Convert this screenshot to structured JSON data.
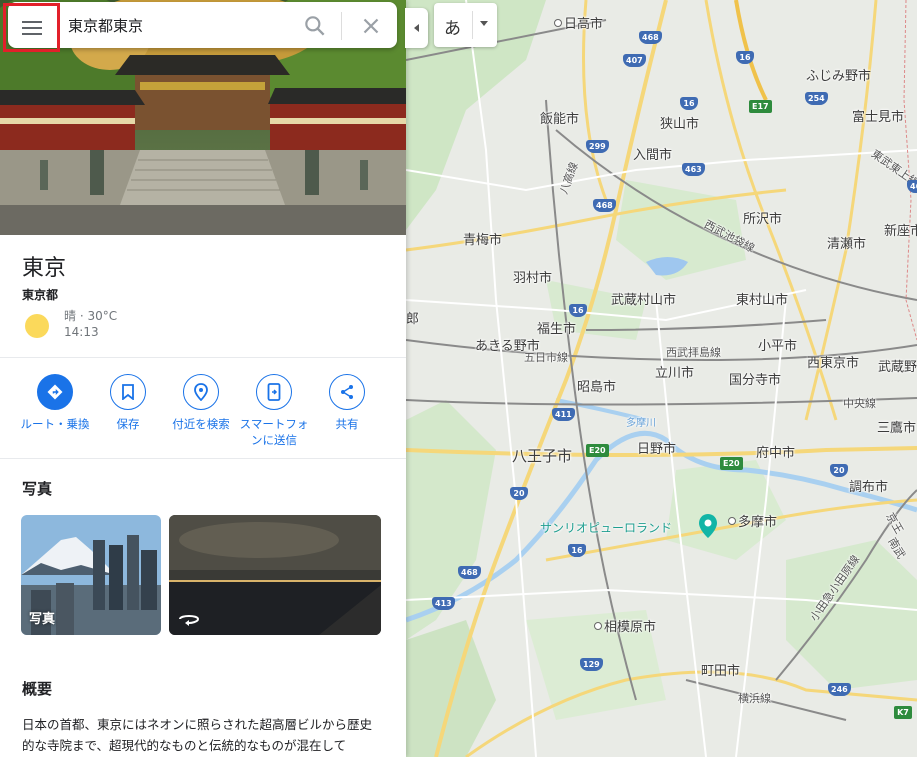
{
  "search": {
    "value": "東京都東京"
  },
  "ime": {
    "char": "あ"
  },
  "place": {
    "title": "東京",
    "subtitle": "東京都",
    "weather": {
      "condition": "晴 · 30°C",
      "time": "14:13",
      "icon": "sun-icon"
    }
  },
  "actions": [
    {
      "label": "ルート・乗換",
      "icon": "directions-icon"
    },
    {
      "label": "保存",
      "icon": "bookmark-icon"
    },
    {
      "label": "付近を検索",
      "icon": "nearby-icon"
    },
    {
      "label": "スマートフォンに送信",
      "icon": "send-to-phone-icon"
    },
    {
      "label": "共有",
      "icon": "share-icon"
    }
  ],
  "photos": {
    "title": "写真",
    "items": [
      {
        "caption": "写真"
      },
      {
        "caption": "",
        "icon": "360-icon"
      }
    ]
  },
  "overview": {
    "title": "概要",
    "text": "日本の首都、東京にはネオンに照らされた超高層ビルから歴史的な寺院まで、超現代的なものと伝統的なものが混在して"
  },
  "map": {
    "labels": [
      {
        "text": "日高市",
        "kind": "city dot"
      },
      {
        "text": "ふじみ野市",
        "kind": "city"
      },
      {
        "text": "富士見市",
        "kind": "city"
      },
      {
        "text": "飯能市",
        "kind": "city"
      },
      {
        "text": "狭山市",
        "kind": "city"
      },
      {
        "text": "入間市",
        "kind": "city"
      },
      {
        "text": "所沢市",
        "kind": "city"
      },
      {
        "text": "清瀬市",
        "kind": "city"
      },
      {
        "text": "新座市",
        "kind": "city"
      },
      {
        "text": "青梅市",
        "kind": "city"
      },
      {
        "text": "羽村市",
        "kind": "city"
      },
      {
        "text": "武蔵村山市",
        "kind": "city"
      },
      {
        "text": "東村山市",
        "kind": "city"
      },
      {
        "text": "福生市",
        "kind": "city"
      },
      {
        "text": "あきる野市",
        "kind": "city"
      },
      {
        "text": "五日市線",
        "kind": "line"
      },
      {
        "text": "小平市",
        "kind": "city"
      },
      {
        "text": "西東京市",
        "kind": "city"
      },
      {
        "text": "武蔵野",
        "kind": "city"
      },
      {
        "text": "昭島市",
        "kind": "city"
      },
      {
        "text": "立川市",
        "kind": "city"
      },
      {
        "text": "国分寺市",
        "kind": "city"
      },
      {
        "text": "中央線",
        "kind": "line"
      },
      {
        "text": "三鷹市",
        "kind": "city"
      },
      {
        "text": "多摩川",
        "kind": "river"
      },
      {
        "text": "八王子市",
        "kind": "city"
      },
      {
        "text": "日野市",
        "kind": "city"
      },
      {
        "text": "府中市",
        "kind": "city"
      },
      {
        "text": "調布市",
        "kind": "city"
      },
      {
        "text": "サンリオピューロランド",
        "kind": "poi"
      },
      {
        "text": "多摩市",
        "kind": "city dot"
      },
      {
        "text": "相模原市",
        "kind": "city dot"
      },
      {
        "text": "町田市",
        "kind": "city"
      },
      {
        "text": "横浜線",
        "kind": "line"
      },
      {
        "text": "西武池袋線",
        "kind": "line"
      },
      {
        "text": "西武拝島線",
        "kind": "line"
      },
      {
        "text": "八高線",
        "kind": "line"
      },
      {
        "text": "小田急小田原線",
        "kind": "line"
      },
      {
        "text": "東武東上線",
        "kind": "line"
      },
      {
        "text": "京王",
        "kind": "line"
      },
      {
        "text": "南武",
        "kind": "line"
      },
      {
        "text": "郎",
        "kind": "city"
      }
    ],
    "shields": [
      {
        "text": "468",
        "kind": "blue"
      },
      {
        "text": "407",
        "kind": "blue"
      },
      {
        "text": "16",
        "kind": "blue"
      },
      {
        "text": "E17",
        "kind": "green"
      },
      {
        "text": "254",
        "kind": "blue"
      },
      {
        "text": "16",
        "kind": "blue"
      },
      {
        "text": "299",
        "kind": "blue"
      },
      {
        "text": "463",
        "kind": "blue"
      },
      {
        "text": "463",
        "kind": "blue"
      },
      {
        "text": "468",
        "kind": "blue"
      },
      {
        "text": "16",
        "kind": "blue"
      },
      {
        "text": "16",
        "kind": "blue"
      },
      {
        "text": "411",
        "kind": "blue"
      },
      {
        "text": "E20",
        "kind": "green"
      },
      {
        "text": "E20",
        "kind": "green"
      },
      {
        "text": "20",
        "kind": "blue"
      },
      {
        "text": "20",
        "kind": "blue"
      },
      {
        "text": "16",
        "kind": "blue"
      },
      {
        "text": "468",
        "kind": "blue"
      },
      {
        "text": "413",
        "kind": "blue"
      },
      {
        "text": "129",
        "kind": "blue"
      },
      {
        "text": "246",
        "kind": "blue"
      },
      {
        "text": "K7",
        "kind": "green"
      }
    ]
  }
}
